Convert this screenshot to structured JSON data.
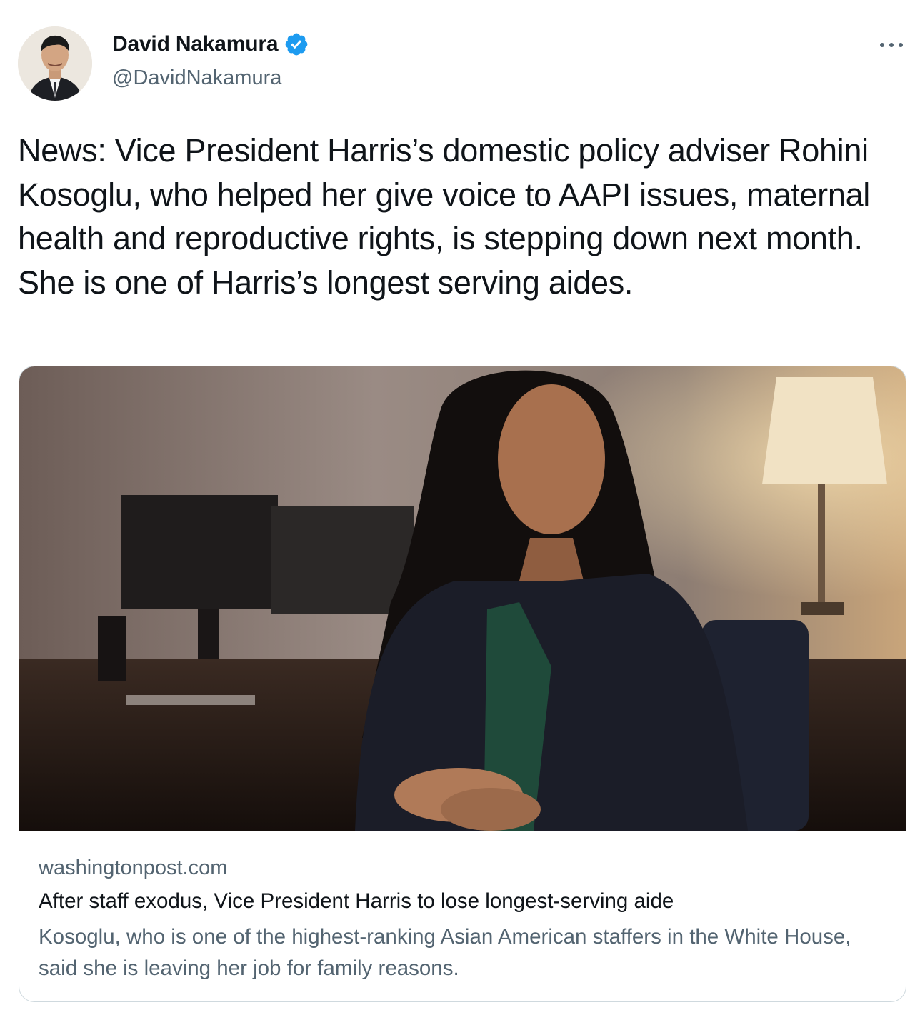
{
  "author": {
    "display_name": "David Nakamura",
    "handle": "@DavidNakamura",
    "verified": true,
    "avatar_icon": "profile-photo-avatar",
    "verified_icon": "verified-badge-icon",
    "verified_color": "#1d9bf0"
  },
  "more_icon": "more-options-icon",
  "tweet": {
    "text": "News: Vice President Harris’s domestic policy adviser Rohini Kosoglu, who helped her give voice to AAPI issues, maternal health and reproductive rights, is stepping down next month. She is one of Harris’s longest serving aides."
  },
  "link_card": {
    "image_icon": "article-photo",
    "domain": "washingtonpost.com",
    "title": "After staff exodus, Vice President Harris to lose longest-serving aide",
    "description": "Kosoglu, who is one of the highest-ranking Asian American staffers in the White House, said she is leaving her job for family reasons."
  },
  "colors": {
    "text_primary": "#0f1419",
    "text_secondary": "#536471",
    "border": "#cfd9de"
  }
}
